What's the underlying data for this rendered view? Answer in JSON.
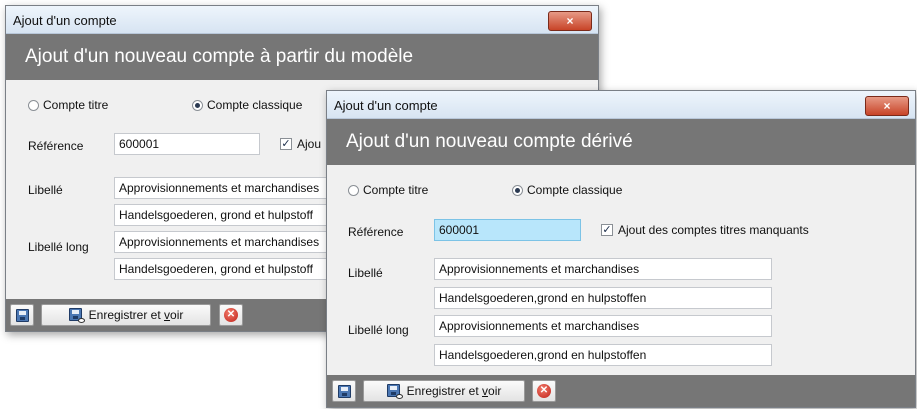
{
  "window_back": {
    "title": "Ajout d'un compte",
    "close_glyph": "×",
    "header": "Ajout d'un nouveau compte à partir du modèle",
    "radio_titre": "Compte titre",
    "radio_classique": "Compte classique",
    "reference_label": "Référence",
    "reference_value": "600001",
    "ajout_label": "Ajou",
    "libelle_label": "Libellé",
    "libelle_fr": "Approvisionnements et marchandises",
    "libelle_nl": "Handelsgoederen, grond et hulpstoff",
    "libelle_long_label": "Libellé long",
    "libelle_long_fr": "Approvisionnements et marchandises",
    "libelle_long_nl": "Handelsgoederen, grond et hulpstoff",
    "save_see_prefix": "Enregistrer et ",
    "save_see_accel": "v",
    "save_see_suffix": "oir"
  },
  "window_front": {
    "title": "Ajout d'un compte",
    "close_glyph": "×",
    "header": "Ajout d'un nouveau compte dérivé",
    "radio_titre": "Compte titre",
    "radio_classique": "Compte classique",
    "reference_label": "Référence",
    "reference_value": "600001",
    "ajout_label": "Ajout des comptes titres manquants",
    "libelle_label": "Libellé",
    "libelle_fr": "Approvisionnements et marchandises",
    "libelle_nl": "Handelsgoederen,grond en hulpstoffen",
    "libelle_long_label": "Libellé long",
    "libelle_long_fr": "Approvisionnements et marchandises",
    "libelle_long_nl": "Handelsgoederen,grond en hulpstoffen",
    "save_see_prefix": "Enregistrer et ",
    "save_see_accel": "v",
    "save_see_suffix": "oir"
  },
  "checkbox_mark": "✓",
  "cancel_glyph": "✕"
}
